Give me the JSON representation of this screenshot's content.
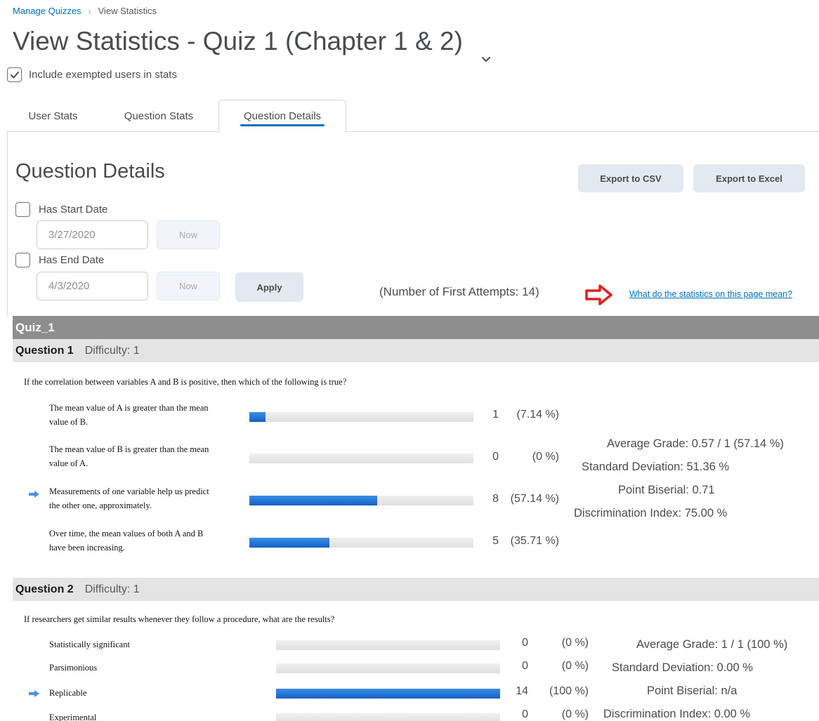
{
  "breadcrumb": {
    "parent": "Manage Quizzes",
    "current": "View Statistics"
  },
  "page_title": "View Statistics - Quiz 1 (Chapter 1 & 2)",
  "exempt_label": "Include exempted users in stats",
  "exempt_checked": true,
  "tabs": [
    {
      "label": "User Stats",
      "active": false
    },
    {
      "label": "Question Stats",
      "active": false
    },
    {
      "label": "Question Details",
      "active": true
    }
  ],
  "section_title": "Question Details",
  "export_csv": "Export to CSV",
  "export_excel": "Export to Excel",
  "start_date": {
    "label": "Has Start Date",
    "value": "3/27/2020",
    "now": "Now"
  },
  "end_date": {
    "label": "Has End Date",
    "value": "4/3/2020",
    "now": "Now"
  },
  "apply_label": "Apply",
  "attempts_text": "(Number of First Attempts: 14)",
  "help_link": "What do the statistics on this page mean?",
  "quiz_name": "Quiz_1",
  "questions": [
    {
      "name": "Question 1",
      "difficulty": "Difficulty: 1",
      "text": "If the correlation between variables A and B is positive, then which of the following is true?",
      "answers": [
        {
          "line1": "The mean value of A is greater than the mean",
          "line2": "value of B.",
          "count": "1",
          "pct": "(7.14 %)",
          "fraction": 0.0714,
          "correct": false
        },
        {
          "line1": "The mean value of B is greater than the mean",
          "line2": "value of A.",
          "count": "0",
          "pct": "(0 %)",
          "fraction": 0,
          "correct": false
        },
        {
          "line1": "Measurements of one variable help us predict",
          "line2": "the other one, approximately.",
          "count": "8",
          "pct": "(57.14 %)",
          "fraction": 0.5714,
          "correct": true
        },
        {
          "line1": "Over time, the mean values of both A and B",
          "line2": "have been increasing.",
          "count": "5",
          "pct": "(35.71 %)",
          "fraction": 0.3571,
          "correct": false
        }
      ],
      "stats": {
        "average": "Average Grade: 0.57 / 1 (57.14 %)",
        "stddev": "Standard Deviation: 51.36 %",
        "biserial": "Point Biserial: 0.71",
        "discrimination": "Discrimination Index: 75.00 %"
      }
    },
    {
      "name": "Question 2",
      "difficulty": "Difficulty: 1",
      "text": "If researchers get similar results whenever they follow a procedure, what are the results?",
      "answers": [
        {
          "label": "Statistically significant",
          "count": "0",
          "pct": "(0 %)",
          "fraction": 0,
          "correct": false
        },
        {
          "label": "Parsimonious",
          "count": "0",
          "pct": "(0 %)",
          "fraction": 0,
          "correct": false
        },
        {
          "label": "Replicable",
          "count": "14",
          "pct": "(100 %)",
          "fraction": 1.0,
          "correct": true
        },
        {
          "label": "Experimental",
          "count": "0",
          "pct": "(0 %)",
          "fraction": 0,
          "correct": false
        }
      ],
      "stats": {
        "average": "Average Grade: 1 / 1 (100 %)",
        "stddev": "Standard Deviation: 0.00 %",
        "biserial": "Point Biserial: n/a",
        "discrimination": "Discrimination Index: 0.00 %"
      }
    }
  ],
  "colors": {
    "link": "#006fbf",
    "bar_fill": "#1f6fd3",
    "quiz_band": "#8e8e8e",
    "question_band": "#e4e4e4",
    "help_arrow": "#e0201b"
  }
}
